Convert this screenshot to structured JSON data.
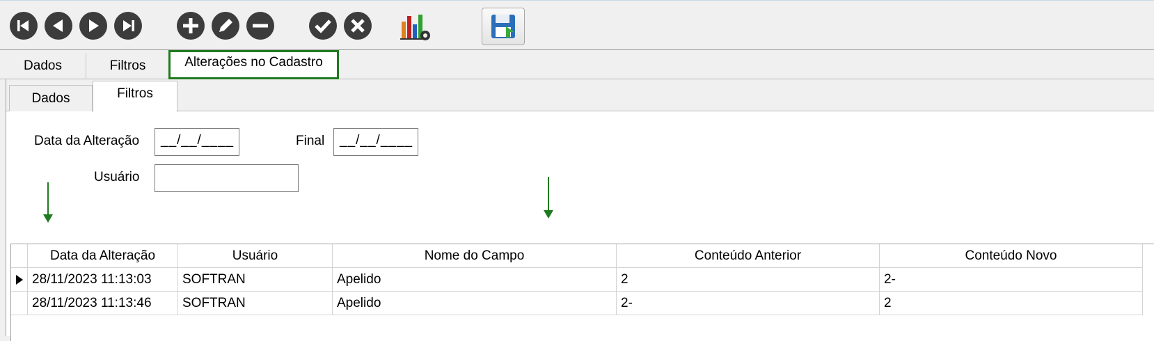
{
  "toolbar": {
    "buttons": [
      {
        "name": "first-record-button",
        "icon": "skip-first-icon"
      },
      {
        "name": "prev-record-button",
        "icon": "prev-icon"
      },
      {
        "name": "next-record-button",
        "icon": "next-icon"
      },
      {
        "name": "last-record-button",
        "icon": "skip-last-icon"
      },
      {
        "name": "add-button",
        "icon": "plus-icon"
      },
      {
        "name": "edit-button",
        "icon": "pencil-icon"
      },
      {
        "name": "delete-button",
        "icon": "minus-icon"
      },
      {
        "name": "confirm-button",
        "icon": "check-icon"
      },
      {
        "name": "cancel-button",
        "icon": "x-icon"
      },
      {
        "name": "chart-settings-button",
        "icon": "bar-chart-gear-icon"
      },
      {
        "name": "save-button",
        "icon": "floppy-disk-icon"
      }
    ]
  },
  "tabs_main": [
    "Dados",
    "Filtros",
    "Alterações no Cadastro"
  ],
  "tabs_sub": [
    "Dados",
    "Filtros"
  ],
  "filters": {
    "data_alteracao_label": "Data da Alteração",
    "data_alteracao_value": "__/__/____",
    "final_label": "Final",
    "final_value": "__/__/____",
    "usuario_label": "Usuário",
    "usuario_value": ""
  },
  "grid": {
    "columns": [
      "Data da Alteração",
      "Usuário",
      "Nome do Campo",
      "Conteúdo Anterior",
      "Conteúdo Novo"
    ],
    "rows": [
      [
        "28/11/2023 11:13:03",
        "SOFTRAN",
        "Apelido",
        "2",
        "2-"
      ],
      [
        "28/11/2023 11:13:46",
        "SOFTRAN",
        "Apelido",
        "2-",
        "2"
      ]
    ]
  },
  "colors": {
    "highlight": "#1f7a1f",
    "icon_dark": "#3c3c3c"
  }
}
